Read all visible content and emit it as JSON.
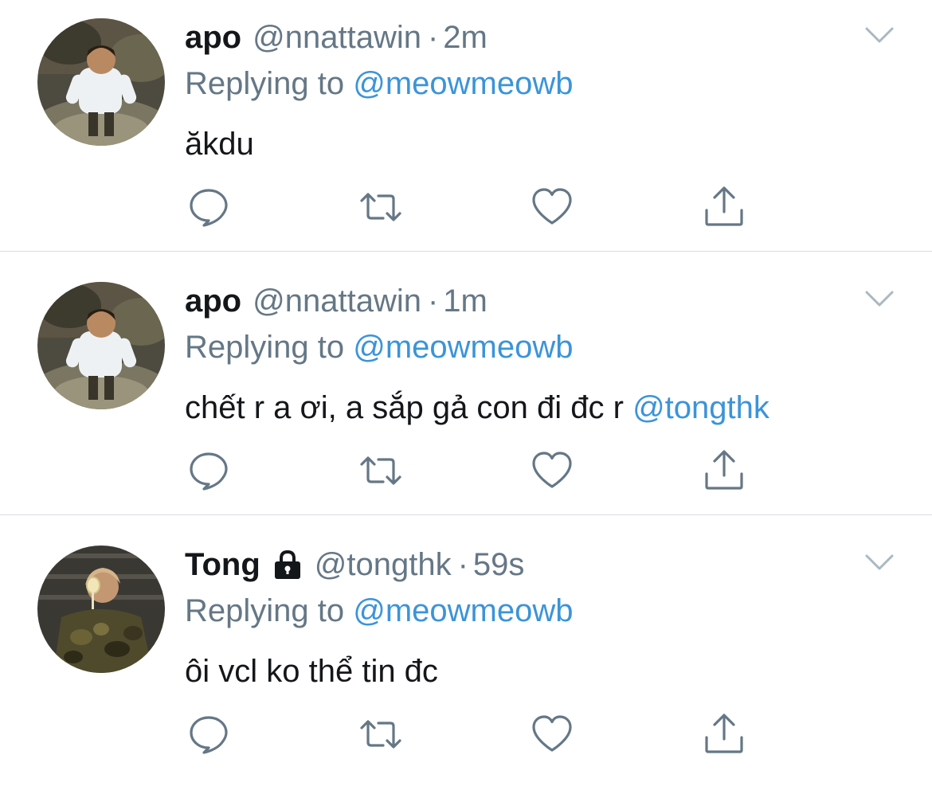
{
  "tweets": [
    {
      "name": "apo",
      "handle": "@nnattawin",
      "separator": "·",
      "time": "2m",
      "replying_prefix": "Replying to",
      "replying_to": "@meowmeowb",
      "text": "ăkdu",
      "text_mention": "",
      "locked": false,
      "avatar": "photo-person-white-shirt"
    },
    {
      "name": "apo",
      "handle": "@nnattawin",
      "separator": "·",
      "time": "1m",
      "replying_prefix": "Replying to",
      "replying_to": "@meowmeowb",
      "text": "chết r a ơi, a sắp gả con đi đc r ",
      "text_mention": "@tongthk",
      "locked": false,
      "avatar": "photo-person-white-shirt"
    },
    {
      "name": "Tong",
      "handle": "@tongthk",
      "separator": "·",
      "time": "59s",
      "replying_prefix": "Replying to",
      "replying_to": "@meowmeowb",
      "text": "ôi vcl ko thể tin đc",
      "text_mention": "",
      "locked": true,
      "avatar": "photo-person-camo-jacket"
    }
  ],
  "icons": {
    "reply": "reply-icon",
    "retweet": "retweet-icon",
    "like": "heart-icon",
    "share": "share-icon",
    "menu": "chevron-down-icon",
    "protected": "lock-icon"
  },
  "colors": {
    "text": "#14171a",
    "secondary": "#657786",
    "link": "#3b94d9",
    "divider": "#d9dde1",
    "icon": "#657786"
  }
}
